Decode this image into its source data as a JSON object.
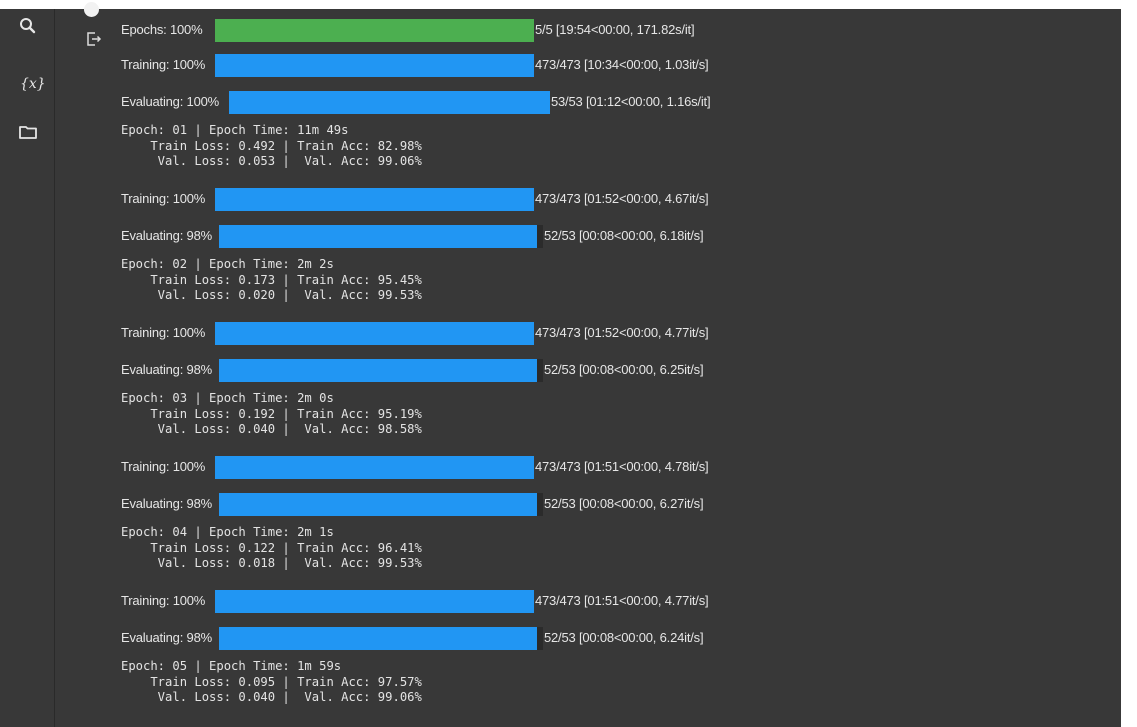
{
  "colors": {
    "progress_blue": "#2196f3",
    "progress_green": "#4caf50",
    "background": "#383838"
  },
  "sidebar": {
    "icons": [
      {
        "name": "search-icon"
      },
      {
        "name": "variables-icon",
        "glyph": "{x}"
      },
      {
        "name": "folder-icon"
      }
    ]
  },
  "output": {
    "epochs_bar": {
      "label": "Epochs: 100%",
      "progress": 1.0,
      "info": "5/5 [19:54<00:00, 171.82s/it]"
    },
    "epochs": [
      {
        "training": {
          "label": "Training: 100%",
          "progress": 1.0,
          "info": "473/473 [10:34<00:00, 1.03it/s]"
        },
        "evaluating": {
          "label": "Evaluating: 100%",
          "progress": 1.0,
          "info": "53/53 [01:12<00:00, 1.16s/it]"
        },
        "stats": [
          "Epoch: 01 | Epoch Time: 11m 49s",
          "\tTrain Loss: 0.492 | Train Acc: 82.98%",
          "\t Val. Loss: 0.053 |  Val. Acc: 99.06%"
        ]
      },
      {
        "training": {
          "label": "Training: 100%",
          "progress": 1.0,
          "info": "473/473 [01:52<00:00, 4.67it/s]"
        },
        "evaluating": {
          "label": "Evaluating: 98%",
          "progress": 0.98,
          "info": "52/53 [00:08<00:00, 6.18it/s]"
        },
        "stats": [
          "Epoch: 02 | Epoch Time: 2m 2s",
          "\tTrain Loss: 0.173 | Train Acc: 95.45%",
          "\t Val. Loss: 0.020 |  Val. Acc: 99.53%"
        ]
      },
      {
        "training": {
          "label": "Training: 100%",
          "progress": 1.0,
          "info": "473/473 [01:52<00:00, 4.77it/s]"
        },
        "evaluating": {
          "label": "Evaluating: 98%",
          "progress": 0.98,
          "info": "52/53 [00:08<00:00, 6.25it/s]"
        },
        "stats": [
          "Epoch: 03 | Epoch Time: 2m 0s",
          "\tTrain Loss: 0.192 | Train Acc: 95.19%",
          "\t Val. Loss: 0.040 |  Val. Acc: 98.58%"
        ]
      },
      {
        "training": {
          "label": "Training: 100%",
          "progress": 1.0,
          "info": "473/473 [01:51<00:00, 4.78it/s]"
        },
        "evaluating": {
          "label": "Evaluating: 98%",
          "progress": 0.98,
          "info": "52/53 [00:08<00:00, 6.27it/s]"
        },
        "stats": [
          "Epoch: 04 | Epoch Time: 2m 1s",
          "\tTrain Loss: 0.122 | Train Acc: 96.41%",
          "\t Val. Loss: 0.018 |  Val. Acc: 99.53%"
        ]
      },
      {
        "training": {
          "label": "Training: 100%",
          "progress": 1.0,
          "info": "473/473 [01:51<00:00, 4.77it/s]"
        },
        "evaluating": {
          "label": "Evaluating: 98%",
          "progress": 0.98,
          "info": "52/53 [00:08<00:00, 6.24it/s]"
        },
        "stats": [
          "Epoch: 05 | Epoch Time: 1m 59s",
          "\tTrain Loss: 0.095 | Train Acc: 97.57%",
          "\t Val. Loss: 0.040 |  Val. Acc: 99.06%"
        ]
      }
    ]
  }
}
